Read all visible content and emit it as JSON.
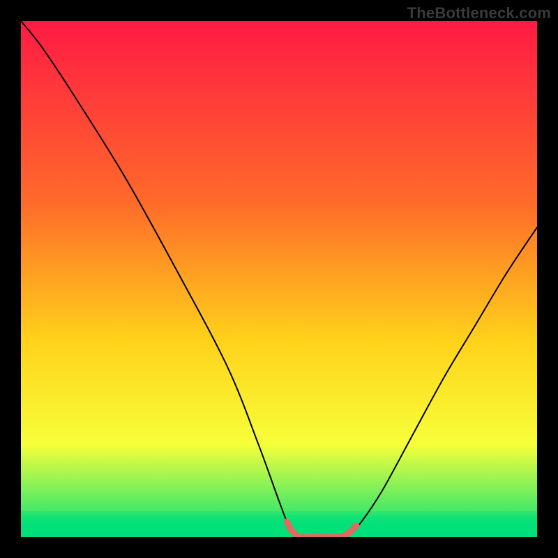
{
  "watermark": "TheBottleneck.com",
  "colors": {
    "background": "#000000",
    "gradient_top": "#ff1a44",
    "gradient_mid1": "#ff6a2a",
    "gradient_mid2": "#ffd21a",
    "gradient_mid3": "#f7ff3a",
    "gradient_bot": "#00e07a",
    "curve": "#000000",
    "highlight": "#e06a5f"
  },
  "chart_data": {
    "type": "line",
    "title": "",
    "xlabel": "",
    "ylabel": "",
    "xlim": [
      0,
      100
    ],
    "ylim": [
      0,
      100
    ],
    "curve": [
      {
        "x": 0,
        "y": 100
      },
      {
        "x": 4,
        "y": 95
      },
      {
        "x": 10,
        "y": 86
      },
      {
        "x": 20,
        "y": 70
      },
      {
        "x": 30,
        "y": 52
      },
      {
        "x": 40,
        "y": 33
      },
      {
        "x": 46,
        "y": 18
      },
      {
        "x": 50,
        "y": 7
      },
      {
        "x": 52,
        "y": 2
      },
      {
        "x": 54,
        "y": 0
      },
      {
        "x": 58,
        "y": 0
      },
      {
        "x": 62,
        "y": 0
      },
      {
        "x": 64,
        "y": 1
      },
      {
        "x": 66,
        "y": 3
      },
      {
        "x": 70,
        "y": 9
      },
      {
        "x": 76,
        "y": 20
      },
      {
        "x": 82,
        "y": 31
      },
      {
        "x": 88,
        "y": 41
      },
      {
        "x": 94,
        "y": 51
      },
      {
        "x": 100,
        "y": 60
      }
    ],
    "highlight": [
      {
        "x": 51.5,
        "y": 3.0
      },
      {
        "x": 52.5,
        "y": 1.2
      },
      {
        "x": 54,
        "y": 0
      },
      {
        "x": 56,
        "y": 0
      },
      {
        "x": 58,
        "y": 0
      },
      {
        "x": 60,
        "y": 0
      },
      {
        "x": 62,
        "y": 0
      },
      {
        "x": 63.5,
        "y": 0.8
      },
      {
        "x": 65,
        "y": 2.2
      }
    ],
    "green_bands": [
      {
        "y_top": 5.0,
        "alpha": 0.35
      },
      {
        "y_top": 4.2,
        "alpha": 0.45
      },
      {
        "y_top": 3.4,
        "alpha": 0.55
      },
      {
        "y_top": 2.6,
        "alpha": 0.7
      },
      {
        "y_top": 1.8,
        "alpha": 0.85
      },
      {
        "y_top": 1.0,
        "alpha": 1.0
      }
    ]
  }
}
